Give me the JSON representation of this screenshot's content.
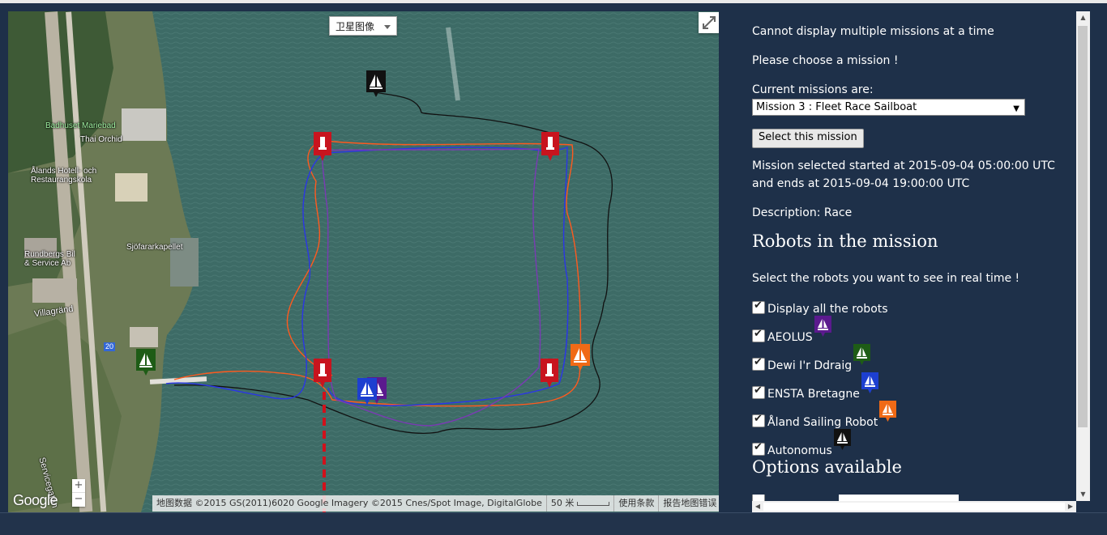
{
  "map": {
    "map_type_label": "卫星图像",
    "labels": {
      "badhuset": "Badhuset Mariebad",
      "thai": "Thai Orchid",
      "alands_hotell_1": "Ålands Hotell- och",
      "alands_hotell_2": "Restaurangskola",
      "sjofarar": "Sjöfararkapellet",
      "rundbergs_1": "Rundbergs Bil",
      "rundbergs_2": "& Service Ab",
      "villagrand": "Villagränd",
      "road": "20",
      "servicegatan": "Servicegatan"
    },
    "zoom_in": "+",
    "zoom_out": "−",
    "google_logo": "Google",
    "attribution": "地图数据 ©2015 GS(2011)6020 Google Imagery ©2015 Cnes/Spot Image, DigitalGlobe",
    "scale_label": "50 米",
    "terms": "使用条款",
    "report": "报告地图错误"
  },
  "panel": {
    "line1": "Cannot display multiple missions at a time",
    "line2": "Please choose a mission !",
    "current_label": "Current missions are:",
    "selected_mission": "Mission 3 : Fleet Race Sailboat",
    "select_button": "Select this mission",
    "started": "Mission selected started at 2015-09-04 05:00:00 UTC",
    "ends": "and ends at 2015-09-04 19:00:00 UTC",
    "description": "Description: Race",
    "robots_heading": "Robots in the mission",
    "robots_instruction": "Select the robots you want to see in real time !",
    "display_all": "Display all the robots",
    "robots": [
      {
        "name": "AEOLUS",
        "color": "#5b1a8e",
        "checked": true
      },
      {
        "name": "Dewi I'r Ddraig",
        "color": "#1e5c16",
        "checked": true
      },
      {
        "name": "ENSTA Bretagne",
        "color": "#1d3fd0",
        "checked": true
      },
      {
        "name": "Åland Sailing Robot",
        "color": "#f06a16",
        "checked": true
      },
      {
        "name": "Autonomus",
        "color": "#111111",
        "checked": true
      }
    ],
    "options_heading": "Options available"
  },
  "colors": {
    "panel_bg": "#1e3049",
    "buoy": "#c8141e",
    "track_orange": "#ff5a1e",
    "track_blue": "#2b36e6",
    "track_purple": "#7a3ab4",
    "track_black": "#111111"
  }
}
